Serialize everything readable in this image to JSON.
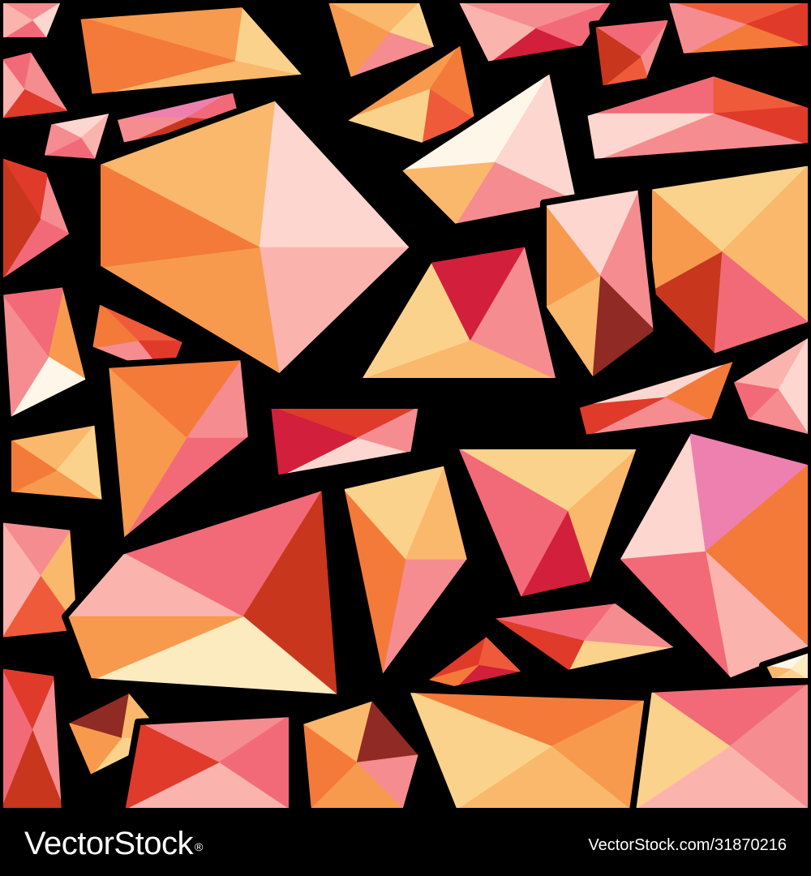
{
  "footer": {
    "brand_name": "VectorStock",
    "brand_mark": "®",
    "image_reference": "VectorStock.com/31870216"
  },
  "palette": {
    "outline": "#000000",
    "crimson": "#D21F3C",
    "red": "#E03A2A",
    "brick": "#C8361E",
    "vermilion": "#EF5B3A",
    "orange": "#F47A3A",
    "tangerine": "#F79A4E",
    "apricot": "#F9B86B",
    "sand": "#FBD28C",
    "cream": "#FDEBC0",
    "pink": "#F26A78",
    "rose": "#F58C90",
    "blush": "#FBB3AE",
    "pale_pink": "#FDD6CF",
    "magenta_pink": "#EE80B0",
    "maroon": "#8F2A24",
    "white": "#FFF6EA"
  }
}
